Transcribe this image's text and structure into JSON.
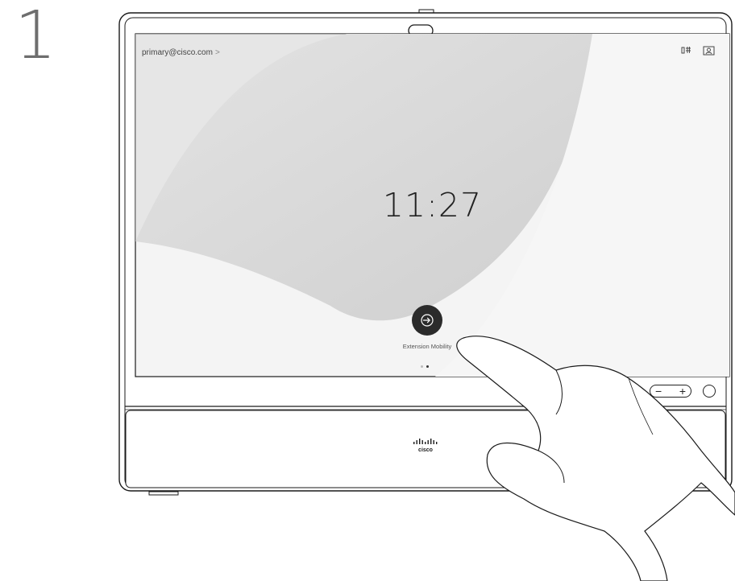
{
  "step": {
    "number": "1"
  },
  "screen": {
    "account": "primary@cisco.com",
    "account_chevron": ">",
    "clock": "11:27",
    "action_button": {
      "label": "Extension Mobility",
      "icon": "login-arrow-icon"
    },
    "status_icons": [
      "headset-status-icon",
      "self-view-icon"
    ],
    "page_indicator": {
      "count": 2,
      "active": 2
    }
  },
  "hardware": {
    "volume_minus": "−",
    "volume_plus": "+",
    "brand": "cisco"
  },
  "colors": {
    "screen_bg": "#f4f4f4",
    "button_dark": "#2b2b2b",
    "outline": "#1a1a1a"
  }
}
